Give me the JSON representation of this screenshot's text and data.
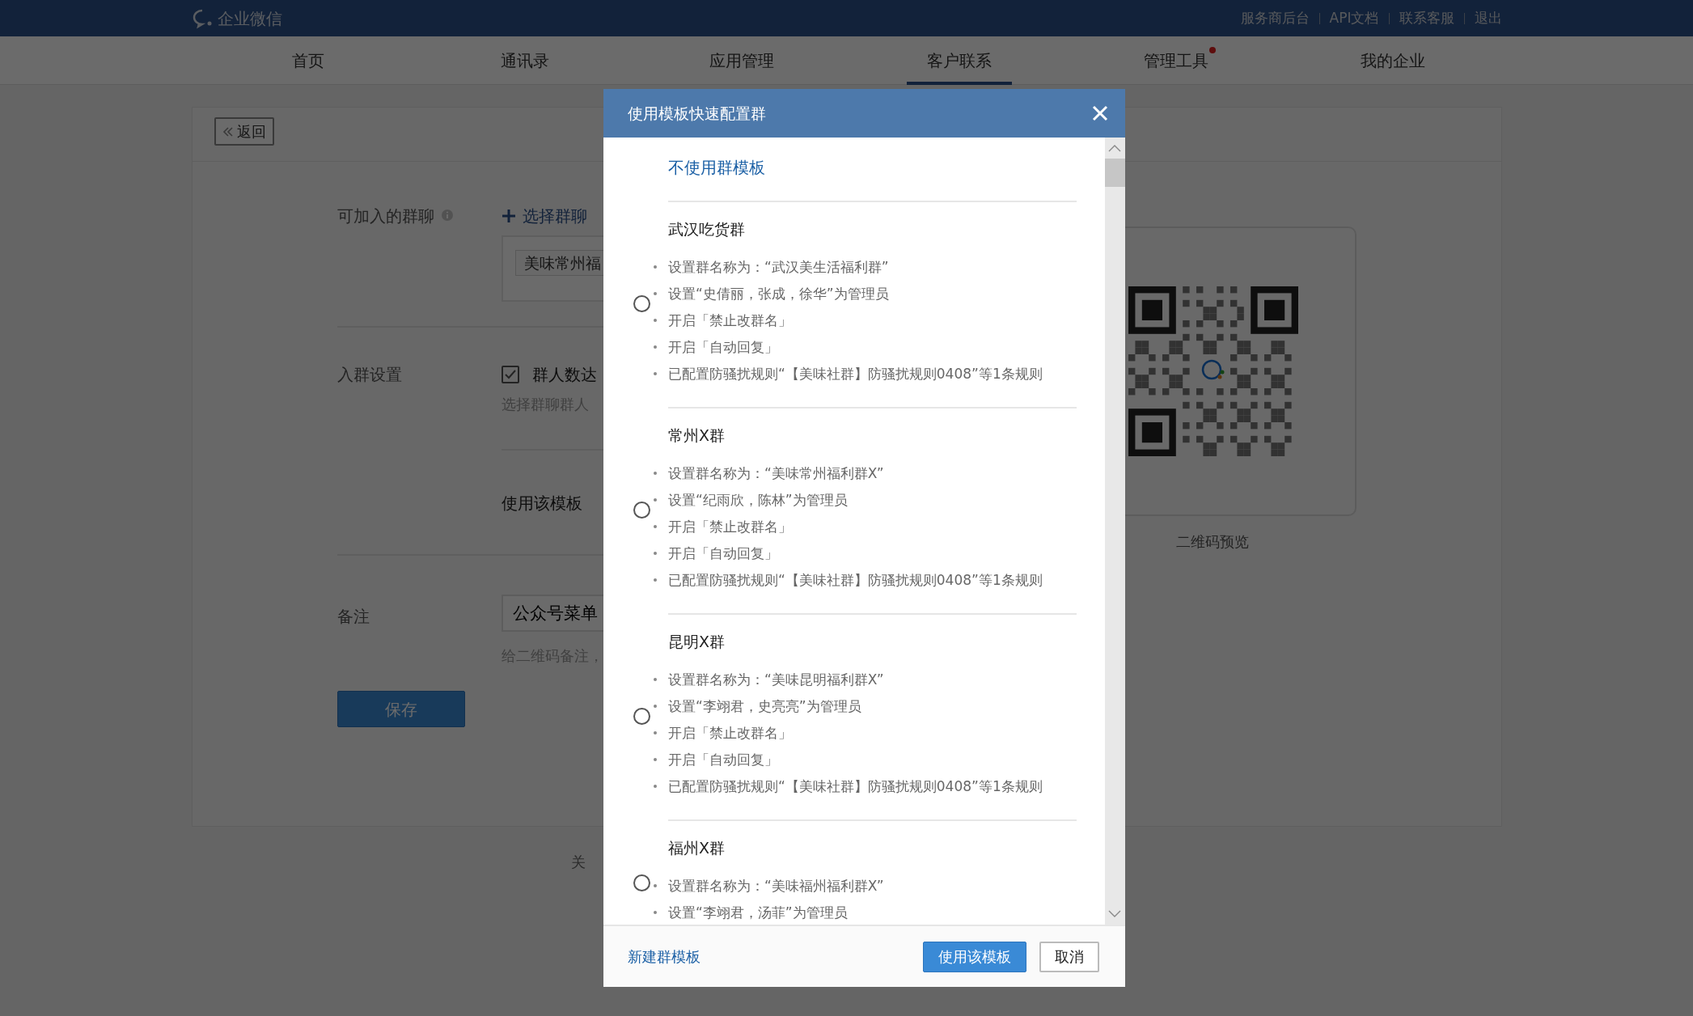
{
  "top_bar": {
    "logo": "企业微信",
    "links": [
      "服务商后台",
      "API文档",
      "联系客服",
      "退出"
    ]
  },
  "nav": {
    "tabs": [
      {
        "label": "首页",
        "selected": false,
        "badge": false
      },
      {
        "label": "通讯录",
        "selected": false,
        "badge": false
      },
      {
        "label": "应用管理",
        "selected": false,
        "badge": false
      },
      {
        "label": "客户联系",
        "selected": true,
        "badge": false
      },
      {
        "label": "管理工具",
        "selected": false,
        "badge": true
      },
      {
        "label": "我的企业",
        "selected": false,
        "badge": false
      }
    ]
  },
  "form": {
    "back_button": "返回",
    "group_chats": {
      "label": "可加入的群聊",
      "add_button": "选择群聊",
      "selected_chat": "美味常州福"
    },
    "join_settings": {
      "label": "入群设置",
      "checkbox": {
        "label": "群人数达",
        "checked": true
      },
      "hint": "选择群聊群人",
      "template_label": "使用该模板"
    },
    "remark": {
      "label": "备注",
      "value": "公众号菜单",
      "hint": "给二维码备注，"
    },
    "save_button": "保存"
  },
  "qr_preview": {
    "caption": "二维码预览"
  },
  "footer": {
    "text": "关"
  },
  "modal": {
    "title": "使用模板快速配置群",
    "options": [
      {
        "kind": "none",
        "label": "不使用群模板",
        "selected": false
      },
      {
        "kind": "template",
        "name": "武汉吃货群",
        "selected": false,
        "rules": [
          "设置群名称为：“武汉美生活福利群”",
          "设置“史倩丽，张成，徐华”为管理员",
          "开启「禁止改群名」",
          "开启「自动回复」",
          "已配置防骚扰规则“【美味社群】防骚扰规则0408”等1条规则"
        ]
      },
      {
        "kind": "template",
        "name": "常州X群",
        "selected": false,
        "rules": [
          "设置群名称为：“美味常州福利群X”",
          "设置“纪雨欣，陈林”为管理员",
          "开启「禁止改群名」",
          "开启「自动回复」",
          "已配置防骚扰规则“【美味社群】防骚扰规则0408”等1条规则"
        ]
      },
      {
        "kind": "template",
        "name": "昆明X群",
        "selected": false,
        "rules": [
          "设置群名称为：“美味昆明福利群X”",
          "设置“李翊君，史亮亮”为管理员",
          "开启「禁止改群名」",
          "开启「自动回复」",
          "已配置防骚扰规则“【美味社群】防骚扰规则0408”等1条规则"
        ]
      },
      {
        "kind": "template",
        "name": "福州X群",
        "selected": false,
        "rules": [
          "设置群名称为：“美味福州福利群X”",
          "设置“李翊君，汤菲”为管理员"
        ]
      }
    ],
    "new_template_link": "新建群模板",
    "buttons": [
      {
        "label": "使用该模板",
        "kind": "primary"
      },
      {
        "label": "取消",
        "kind": "secondary"
      }
    ]
  }
}
